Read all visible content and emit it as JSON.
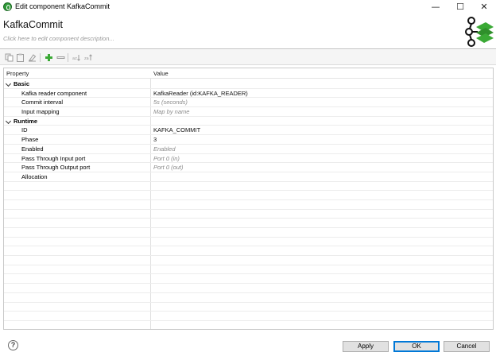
{
  "window": {
    "title": "Edit component KafkaCommit",
    "min_glyph": "—",
    "max_glyph": "☐",
    "close_glyph": "✕"
  },
  "header": {
    "component_name": "KafkaCommit",
    "description_placeholder": "Click here to edit component description..."
  },
  "toolbar": {
    "icons": [
      "copy-icon",
      "paste-icon",
      "clear-icon",
      "add-icon",
      "remove-icon",
      "sort-az-icon",
      "sort-za-icon"
    ]
  },
  "table": {
    "columns": {
      "property": "Property",
      "value": "Value"
    },
    "groups": [
      {
        "name": "Basic",
        "rows": [
          {
            "property": "Kafka reader component",
            "value": "KafkaReader (id:KAFKA_READER)",
            "is_default": false
          },
          {
            "property": "Commit interval",
            "value": "5s (seconds)",
            "is_default": true
          },
          {
            "property": "Input mapping",
            "value": "Map by name",
            "is_default": true
          }
        ]
      },
      {
        "name": "Runtime",
        "rows": [
          {
            "property": "ID",
            "value": "KAFKA_COMMIT",
            "is_default": false
          },
          {
            "property": "Phase",
            "value": "3",
            "is_default": false
          },
          {
            "property": "Enabled",
            "value": "Enabled",
            "is_default": true
          },
          {
            "property": "Pass Through Input port",
            "value": "Port 0 (in)",
            "is_default": true
          },
          {
            "property": "Pass Through Output port",
            "value": "Port 0 (out)",
            "is_default": true
          },
          {
            "property": "Allocation",
            "value": "",
            "is_default": false
          }
        ]
      }
    ]
  },
  "footer": {
    "help_glyph": "?",
    "apply_label": "Apply",
    "ok_label": "OK",
    "cancel_label": "Cancel"
  },
  "colors": {
    "accent": "#0078d7",
    "logo_green": "#3aa935"
  }
}
